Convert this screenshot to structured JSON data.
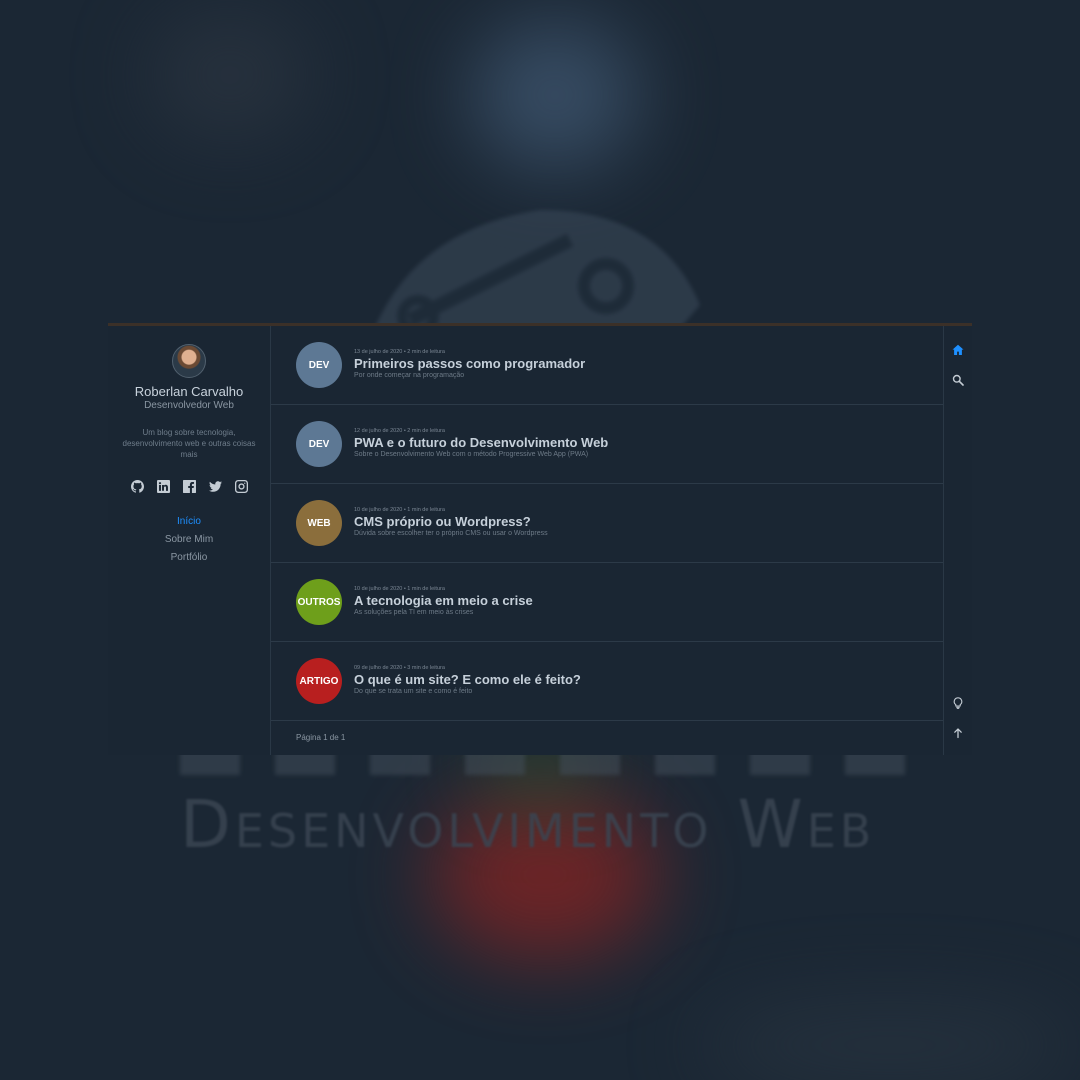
{
  "background": {
    "watermark_text": "Desenvolvimento Web"
  },
  "author": {
    "name": "Roberlan Carvalho",
    "role": "Desenvolvedor Web",
    "bio": "Um blog sobre tecnologia, desenvolvimento web e outras coisas mais"
  },
  "social": [
    {
      "name": "github-icon"
    },
    {
      "name": "linkedin-icon"
    },
    {
      "name": "facebook-icon"
    },
    {
      "name": "twitter-icon"
    },
    {
      "name": "instagram-icon"
    }
  ],
  "nav": {
    "items": [
      {
        "label": "Início",
        "active": true
      },
      {
        "label": "Sobre Mim",
        "active": false
      },
      {
        "label": "Portfólio",
        "active": false
      }
    ]
  },
  "posts": [
    {
      "tag": "DEV",
      "color": "#5d7894",
      "meta": "13 de julho de 2020 • 2 min de leitura",
      "title": "Primeiros passos como programador",
      "description": "Por onde começar na programação"
    },
    {
      "tag": "DEV",
      "color": "#5d7894",
      "meta": "12 de julho de 2020 • 2 min de leitura",
      "title": "PWA e o futuro do Desenvolvimento Web",
      "description": "Sobre o Desenvolvimento Web com o método Progressive Web App (PWA)"
    },
    {
      "tag": "WEB",
      "color": "#8b6e3c",
      "meta": "10 de julho de 2020 • 1 min de leitura",
      "title": "CMS próprio ou Wordpress?",
      "description": "Dúvida sobre escolher ter o próprio CMS ou usar o Wordpress"
    },
    {
      "tag": "OUTROS",
      "color": "#6e9f1b",
      "meta": "10 de julho de 2020 • 1 min de leitura",
      "title": "A tecnologia em meio a crise",
      "description": "As soluções pela TI em meio às crises"
    },
    {
      "tag": "ARTIGO",
      "color": "#b81f1f",
      "meta": "09 de julho de 2020 • 3 min de leitura",
      "title": "O que é um site? E como ele é feito?",
      "description": "Do que se trata um site e como é feito"
    }
  ],
  "pagination": {
    "label": "Página 1 de 1"
  },
  "colors": {
    "accent": "#1e90ff",
    "background": "#1a2633"
  },
  "rightbar": {
    "top": [
      "home-icon",
      "search-icon"
    ],
    "bottom": [
      "lightbulb-icon",
      "arrow-up-icon"
    ]
  }
}
